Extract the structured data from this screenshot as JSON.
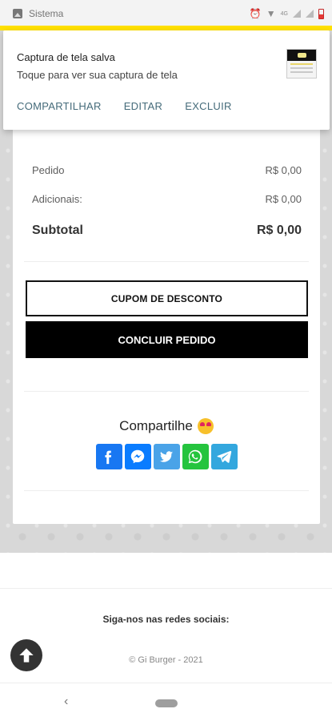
{
  "status_bar": {
    "app_name": "Sistema",
    "network": "4G"
  },
  "notification": {
    "title": "Captura de tela salva",
    "subtitle": "Toque para ver sua captura de tela",
    "actions": [
      "COMPARTILHAR",
      "EDITAR",
      "EXCLUIR"
    ],
    "accent_color": "#ffe000"
  },
  "order_summary": {
    "rows": [
      {
        "label": "Pedido",
        "value": "R$ 0,00"
      },
      {
        "label": "Adicionais:",
        "value": "R$ 0,00"
      }
    ],
    "subtotal_label": "Subtotal",
    "subtotal_value": "R$ 0,00"
  },
  "buttons": {
    "coupon_label": "CUPOM DE DESCONTO",
    "finish_label": "CONCLUIR PEDIDO"
  },
  "share": {
    "title": "Compartilhe",
    "networks": [
      {
        "name": "facebook-icon",
        "color": "#1877f2"
      },
      {
        "name": "messenger-icon",
        "color": "#0a7cff"
      },
      {
        "name": "twitter-icon",
        "color": "#4aa3e8"
      },
      {
        "name": "whatsapp-icon",
        "color": "#25c43e"
      },
      {
        "name": "telegram-icon",
        "color": "#33a7de"
      }
    ]
  },
  "footer": {
    "follow_text": "Siga-nos nas redes sociais:",
    "copyright": "© Gi Burger - 2021"
  },
  "nav_bar": {
    "back_glyph": "‹"
  }
}
